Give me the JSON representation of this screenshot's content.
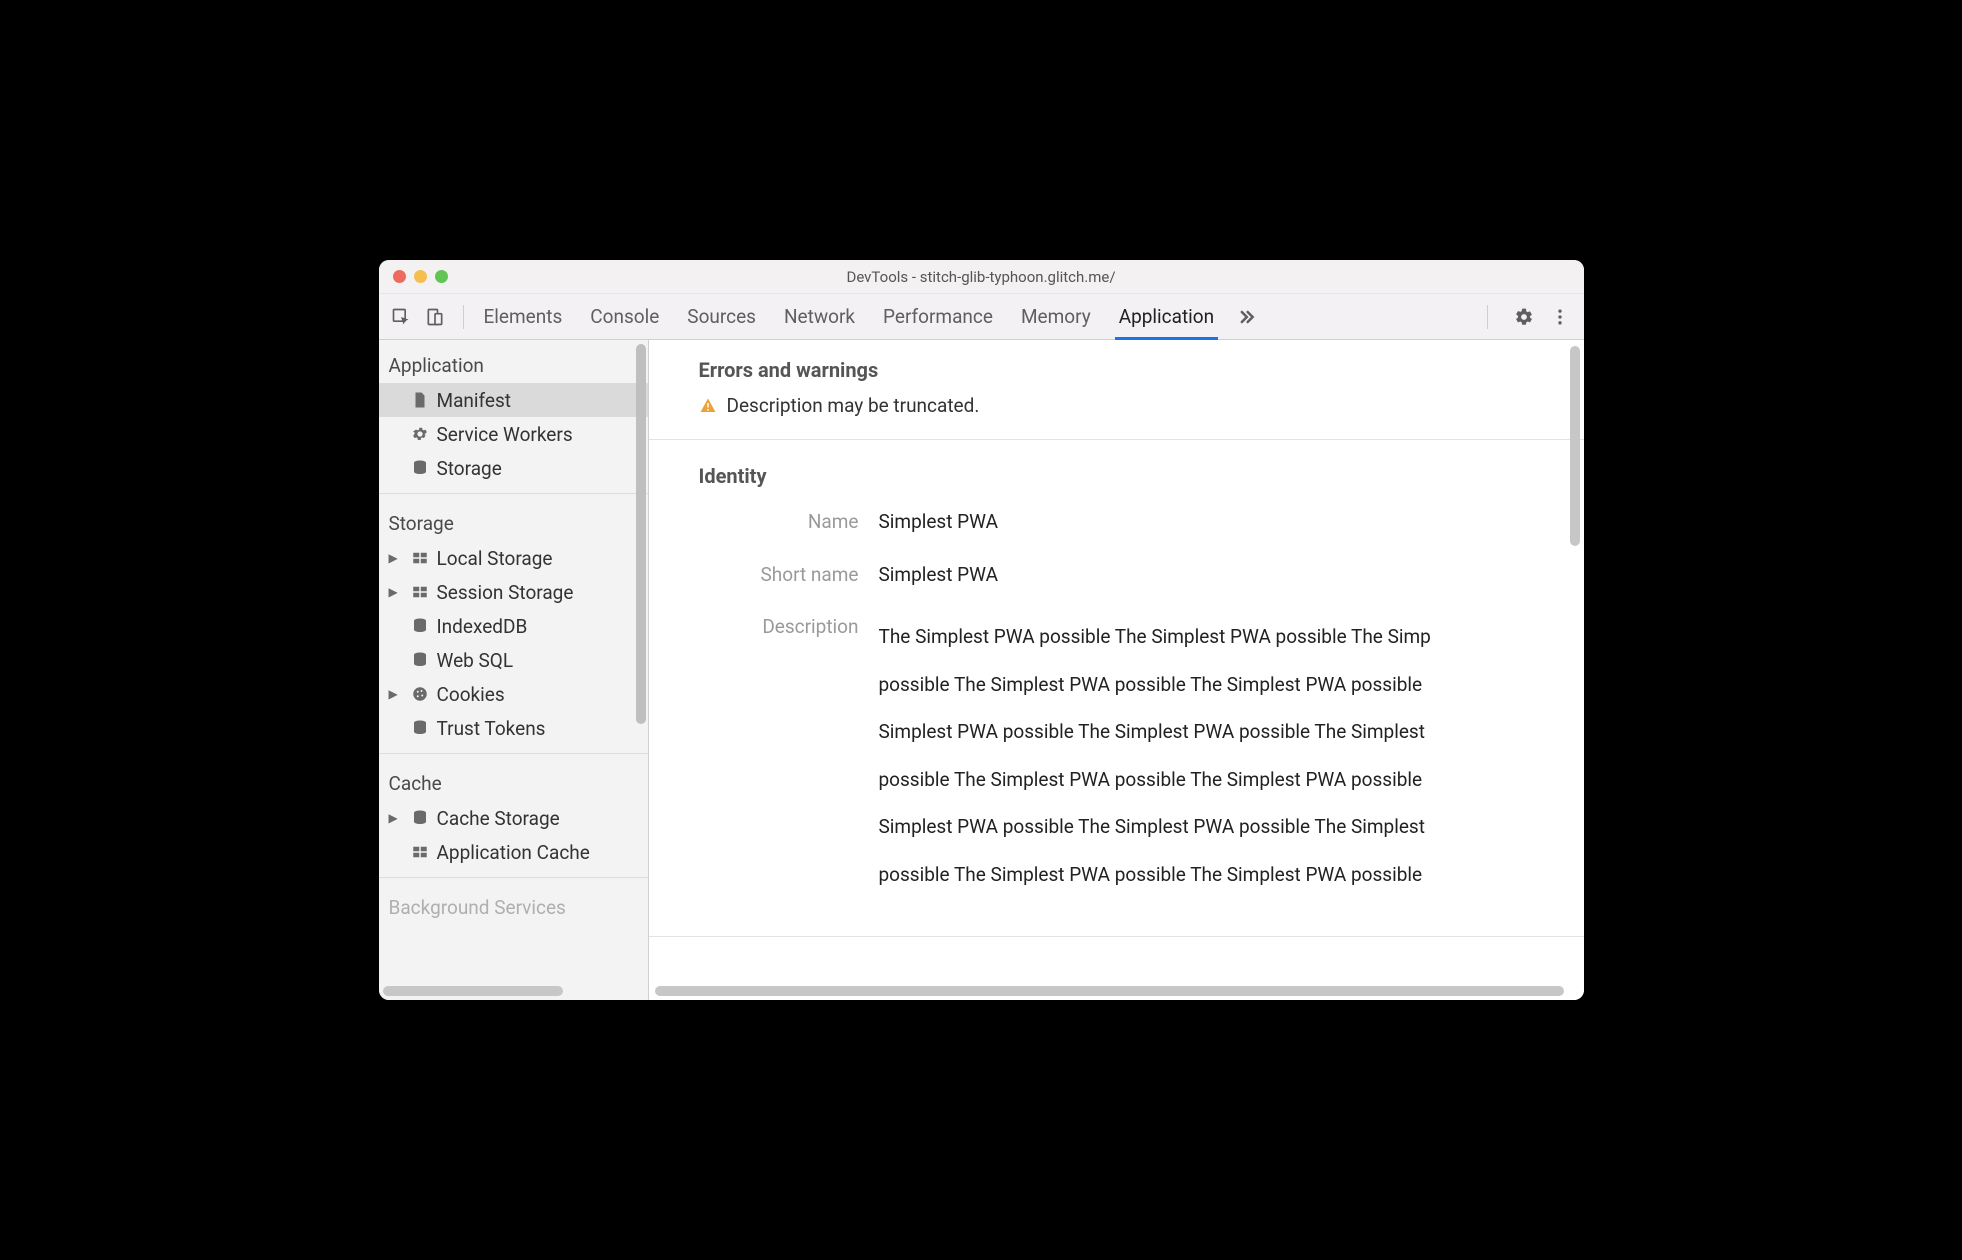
{
  "window": {
    "title": "DevTools - stitch-glib-typhoon.glitch.me/"
  },
  "tabs": {
    "items": [
      "Elements",
      "Console",
      "Sources",
      "Network",
      "Performance",
      "Memory",
      "Application"
    ],
    "active": "Application"
  },
  "sidebar": {
    "sections": [
      {
        "title": "Application",
        "items": [
          {
            "label": "Manifest",
            "icon": "file-icon",
            "selected": true
          },
          {
            "label": "Service Workers",
            "icon": "gear-icon"
          },
          {
            "label": "Storage",
            "icon": "database-icon"
          }
        ]
      },
      {
        "title": "Storage",
        "items": [
          {
            "label": "Local Storage",
            "icon": "table-icon",
            "expandable": true
          },
          {
            "label": "Session Storage",
            "icon": "table-icon",
            "expandable": true
          },
          {
            "label": "IndexedDB",
            "icon": "database-icon"
          },
          {
            "label": "Web SQL",
            "icon": "database-icon"
          },
          {
            "label": "Cookies",
            "icon": "cookie-icon",
            "expandable": true
          },
          {
            "label": "Trust Tokens",
            "icon": "database-icon"
          }
        ]
      },
      {
        "title": "Cache",
        "items": [
          {
            "label": "Cache Storage",
            "icon": "database-icon",
            "expandable": true
          },
          {
            "label": "Application Cache",
            "icon": "table-icon"
          }
        ]
      },
      {
        "title": "Background Services",
        "items": []
      }
    ]
  },
  "main": {
    "errors_warnings": {
      "heading": "Errors and warnings",
      "items": [
        {
          "type": "warning",
          "text": "Description may be truncated."
        }
      ]
    },
    "identity": {
      "heading": "Identity",
      "name_label": "Name",
      "name_value": "Simplest PWA",
      "short_name_label": "Short name",
      "short_name_value": "Simplest PWA",
      "description_label": "Description",
      "description_value": "The Simplest PWA possible The Simplest PWA possible The Simp\npossible The Simplest PWA possible The Simplest PWA possible \nSimplest PWA possible The Simplest PWA possible The Simplest\npossible The Simplest PWA possible The Simplest PWA possible \nSimplest PWA possible The Simplest PWA possible The Simplest\npossible The Simplest PWA possible The Simplest PWA possible"
    }
  }
}
